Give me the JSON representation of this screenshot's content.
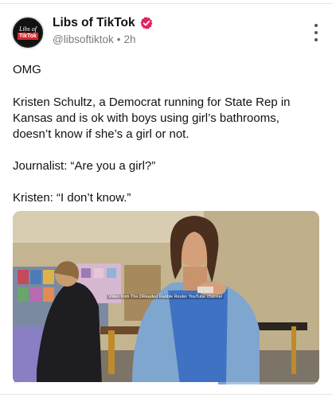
{
  "post": {
    "author": {
      "display_name": "Libs of TikTok",
      "handle": "@libsoftiktok",
      "time": "2h",
      "separator": "•",
      "verified_color": "#e0245e",
      "avatar_line1": "Libs of",
      "avatar_line2": "TikTok"
    },
    "text_paragraphs": [
      "OMG",
      "Kristen Schultz, a Democrat running for State Rep in Kansas and is ok with boys using girl’s bathrooms, doesn’t know if she’s a girl or not.",
      "Journalist: “Are you a girl?”",
      "Kristen: “I don’t know.”"
    ],
    "media": {
      "overlay_caption": "Video from The DReaded Rabble Reuter YouTube channel",
      "progress_fraction": 0.67
    },
    "icons": {
      "more": "more-vertical-icon",
      "verified": "verified-badge-icon"
    }
  }
}
